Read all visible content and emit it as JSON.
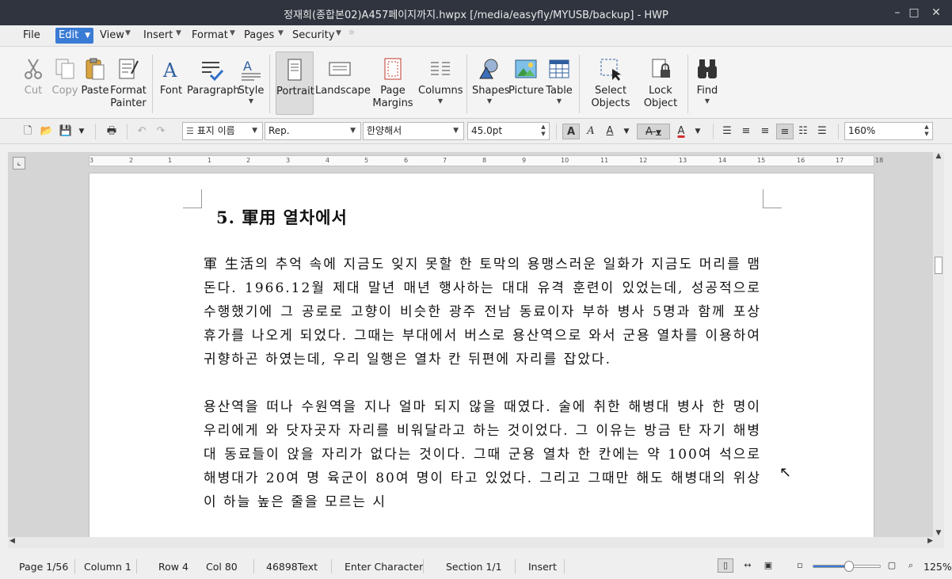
{
  "window": {
    "title": "정재희(종합본02)A457페이지까지.hwpx [/media/easyfly/MYUSB/backup] - HWP",
    "controls": [
      "–",
      "□",
      "✕"
    ]
  },
  "menubar": {
    "items": [
      {
        "label": "File"
      },
      {
        "label": "Edit"
      },
      {
        "label": "View"
      },
      {
        "label": "Insert"
      },
      {
        "label": "Format"
      },
      {
        "label": "Pages"
      },
      {
        "label": "Security"
      }
    ]
  },
  "ribbon": {
    "cut": "Cut",
    "copy": "Copy",
    "paste": "Paste",
    "format_painter": [
      "Format",
      "Painter"
    ],
    "font": "Font",
    "paragraph": "Paragraph",
    "style": "Style",
    "portrait": "Portrait",
    "landscape": "Landscape",
    "page_margins": [
      "Page",
      "Margins"
    ],
    "columns": "Columns",
    "shapes": "Shapes",
    "picture": "Picture",
    "table": "Table",
    "select_objects": [
      "Select",
      "Objects"
    ],
    "lock_object": [
      "Lock",
      "Object"
    ],
    "find": "Find"
  },
  "toolbar": {
    "style_value": "표지 이름",
    "font_family_value": "Rep.",
    "font_face_value": "한양해서",
    "font_size_value": "45.0pt",
    "zoom_value": "160%",
    "text_color": "#d32f2f"
  },
  "ruler": {
    "ticks": [
      "3",
      "2",
      "1",
      "1",
      "2",
      "3",
      "4",
      "5",
      "6",
      "7",
      "8",
      "9",
      "10",
      "11",
      "12",
      "13",
      "14",
      "15",
      "16",
      "17",
      "18"
    ]
  },
  "document": {
    "heading": "5. 軍用 열차에서",
    "paragraphs": [
      "軍 生活의 추억 속에 지금도 잊지 못할 한 토막의 용맹스러운 일화가 지금도 머리를 맴돈다. 1966.12월 제대 말년 매년 행사하는 대대 유격 훈련이 있었는데, 성공적으로 수행했기에 그 공로로 고향이 비슷한 광주 전남 동료이자 부하 병사 5명과 함께 포상 휴가를 나오게 되었다. 그때는 부대에서 버스로 용산역으로 와서 군용 열차를 이용하여 귀향하곤 하였는데, 우리 일행은 열차 칸 뒤편에 자리를 잡았다.",
      "용산역을 떠나 수원역을 지나 얼마 되지 않을 때였다. 술에 취한 해병대 병사 한 명이 우리에게 와 닷자곳자 자리를 비워달라고 하는 것이었다. 그 이유는 방금 탄 자기 해병대 동료들이 앉을 자리가 없다는 것이다. 그때 군용 열차 한 칸에는 약 100여 석으로 해병대가 20여 명 육군이 80여 명이 타고 있었다. 그리고 그때만 해도 해병대의 위상이 하늘 높은 줄을 모르는 시"
    ]
  },
  "statusbar": {
    "page": "Page 1/56",
    "column": "Column 1",
    "row": "Row 4",
    "col": "Col 80",
    "text_count": "46898Text",
    "mode": "Enter Character",
    "section": "Section 1/1",
    "insert": "Insert",
    "zoom": "125%",
    "zoom_level_fraction": 0.52
  }
}
